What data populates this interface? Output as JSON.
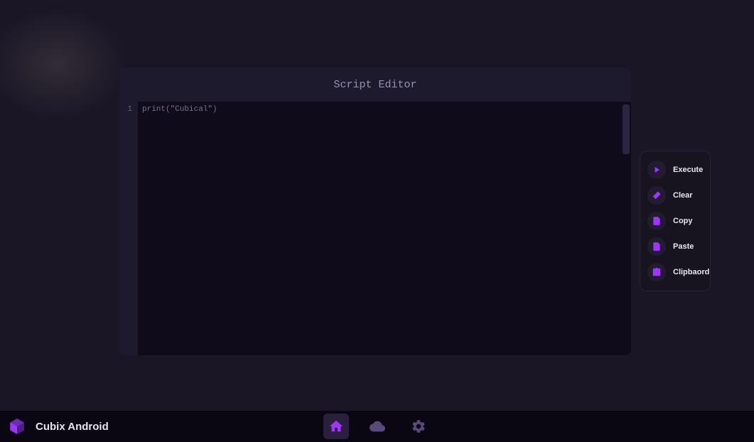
{
  "editor": {
    "title": "Script Editor",
    "lines": [
      {
        "num": "1",
        "text": "print(\"Cubical\")"
      }
    ]
  },
  "actions": {
    "execute": "Execute",
    "clear": "Clear",
    "copy": "Copy",
    "paste": "Paste",
    "clipboard": "Clipbaord"
  },
  "brand": {
    "name": "Cubix Android"
  },
  "colors": {
    "accent": "#a135ff",
    "accent_muted": "#5a4a7a"
  }
}
